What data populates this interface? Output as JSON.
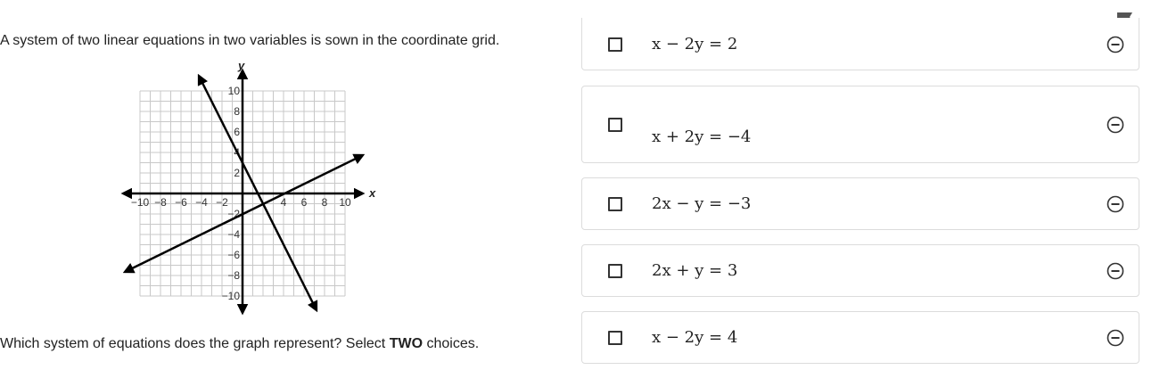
{
  "prompt": "A system of two linear equations in two variables is sown in the coordinate grid.",
  "question": {
    "before": "Which system of equations does the graph represent? Select ",
    "bold": "TWO",
    "after": " choices."
  },
  "graph": {
    "x_axis_label": "x",
    "y_axis_label": "y",
    "x_ticks": [
      "−10",
      "−8",
      "−6",
      "−4",
      "−2",
      "4",
      "6",
      "8",
      "10"
    ],
    "y_ticks": [
      "10",
      "8",
      "6",
      "4",
      "2",
      "−2",
      "−4",
      "−6",
      "−8",
      "−10"
    ],
    "grid": true
  },
  "choices": [
    {
      "lhs": "x − 2y",
      "rhs": "2"
    },
    {
      "lhs": "x + 2y",
      "rhs": "−4"
    },
    {
      "lhs": "2x − y",
      "rhs": "−3"
    },
    {
      "lhs": "2x + y",
      "rhs": "3"
    },
    {
      "lhs": "x − 2y",
      "rhs": "4"
    }
  ],
  "icons": {
    "flag": "flag-icon",
    "eliminate": "minus-circle-icon",
    "checkbox": "checkbox-icon"
  }
}
